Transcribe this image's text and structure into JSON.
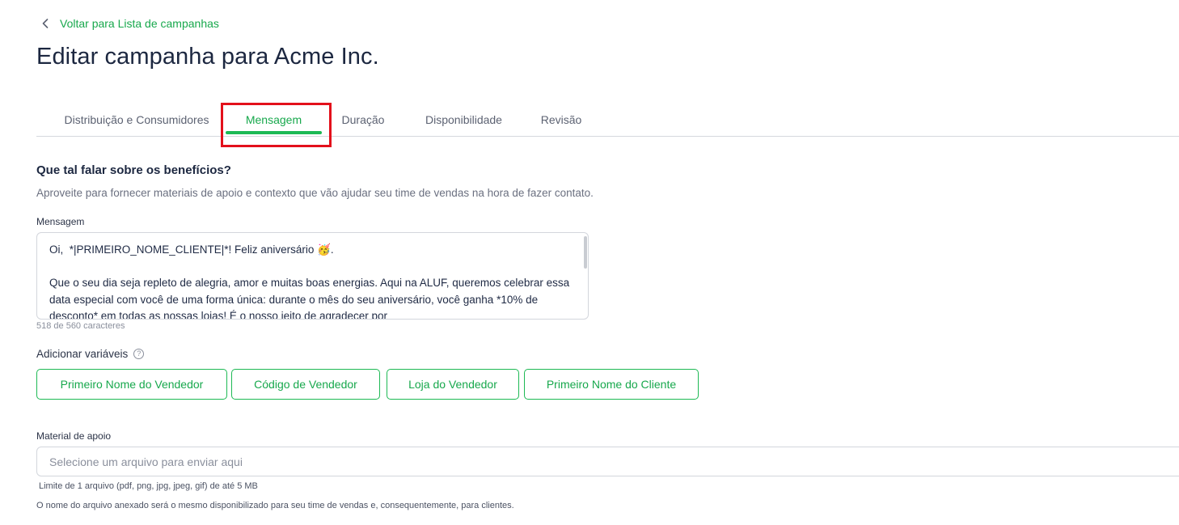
{
  "back_link": {
    "label": "Voltar para Lista de campanhas"
  },
  "page_title": "Editar campanha para Acme Inc.",
  "tabs": [
    {
      "label": "Distribuição e Consumidores",
      "active": false
    },
    {
      "label": "Mensagem",
      "active": true
    },
    {
      "label": "Duração",
      "active": false
    },
    {
      "label": "Disponibilidade",
      "active": false
    },
    {
      "label": "Revisão",
      "active": false
    }
  ],
  "section": {
    "title": "Que tal falar sobre os benefícios?",
    "description": "Aproveite para fornecer materiais de apoio e contexto que vão ajudar seu time de vendas na hora de fazer contato."
  },
  "message": {
    "label": "Mensagem",
    "value": "Oi,  *|PRIMEIRO_NOME_CLIENTE|*! Feliz aniversário 🥳.\n\nQue o seu dia seja repleto de alegria, amor e muitas boas energias. Aqui na ALUF, queremos celebrar essa data especial com você de uma forma única: durante o mês do seu aniversário, você ganha *10% de desconto* em todas as nossas lojas! É o nosso jeito de agradecer por",
    "char_count": "518 de 560 caracteres"
  },
  "variables": {
    "label": "Adicionar variáveis",
    "help_icon": "?",
    "buttons": [
      "Primeiro Nome do Vendedor",
      "Código de Vendedor",
      "Loja do Vendedor",
      "Primeiro Nome do Cliente"
    ]
  },
  "support_material": {
    "label": "Material de apoio",
    "placeholder": "Selecione um arquivo para enviar aqui",
    "limit_hint": "Limite de 1 arquivo (pdf, png, jpg, jpeg, gif) de até 5 MB",
    "name_hint": "O nome do arquivo anexado será o mesmo disponibilizado para seu time de vendas e, consequentemente, para clientes."
  },
  "colors": {
    "accent": "#1db954",
    "highlight": "#e3101b",
    "title": "#1c2740"
  }
}
